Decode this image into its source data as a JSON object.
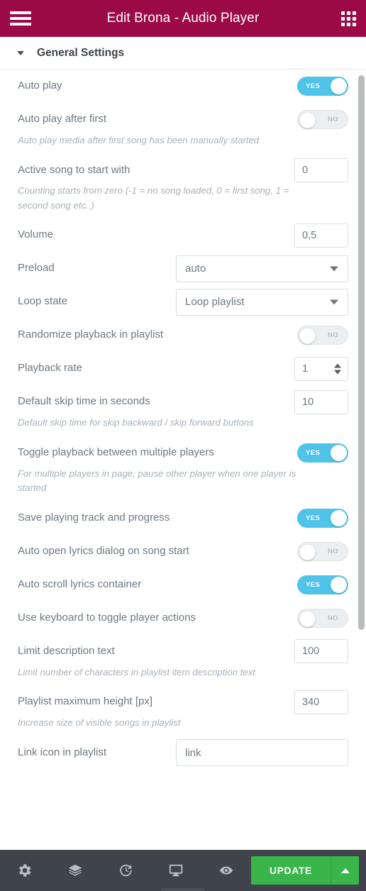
{
  "header": {
    "title": "Edit Brona - Audio Player",
    "menu_icon": "hamburger-icon",
    "apps_icon": "grid-apps-icon",
    "bg_color": "#9b0a46"
  },
  "section": {
    "title": "General Settings",
    "collapse_icon": "caret-down-icon"
  },
  "settings": [
    {
      "type": "toggle",
      "label": "Auto play",
      "value": "YES",
      "state": "on"
    },
    {
      "type": "toggle",
      "label": "Auto play after first",
      "value": "NO",
      "state": "off",
      "hint": "Auto play media after first song has been manually started"
    },
    {
      "type": "number",
      "label": "Active song to start with",
      "value": "0",
      "hint": "Counting starts from zero (-1 = no song loaded, 0 = first song, 1 = second song etc..)"
    },
    {
      "type": "number",
      "label": "Volume",
      "value": "0,5"
    },
    {
      "type": "select",
      "label": "Preload",
      "value": "auto"
    },
    {
      "type": "select",
      "label": "Loop state",
      "value": "Loop playlist"
    },
    {
      "type": "toggle",
      "label": "Randomize playback in playlist",
      "value": "NO",
      "state": "off"
    },
    {
      "type": "spinner",
      "label": "Playback rate",
      "value": "1"
    },
    {
      "type": "number",
      "label": "Default skip time in seconds",
      "value": "10",
      "hint": "Default skip time for skip backward / skip forward buttons"
    },
    {
      "type": "toggle",
      "label": "Toggle playback between multiple players",
      "value": "YES",
      "state": "on",
      "hint": "For multiple players in page, pause other player when one player is started"
    },
    {
      "type": "toggle",
      "label": "Save playing track and progress",
      "value": "YES",
      "state": "on"
    },
    {
      "type": "toggle",
      "label": "Auto open lyrics dialog on song start",
      "value": "NO",
      "state": "off"
    },
    {
      "type": "toggle",
      "label": "Auto scroll lyrics container",
      "value": "YES",
      "state": "on"
    },
    {
      "type": "toggle",
      "label": "Use keyboard to toggle player actions",
      "value": "NO",
      "state": "off"
    },
    {
      "type": "number",
      "label": "Limit description text",
      "value": "100",
      "hint": "Limit number of characters in playlist item description text"
    },
    {
      "type": "number",
      "label": "Playlist maximum height [px]",
      "value": "340",
      "hint": "Increase size of visible songs in playlist"
    },
    {
      "type": "text",
      "label": "Link icon in playlist",
      "value": "link"
    }
  ],
  "footer": {
    "icons": [
      {
        "name": "settings-gear-icon",
        "title": "Settings"
      },
      {
        "name": "layers-navigator-icon",
        "title": "Navigator"
      },
      {
        "name": "history-clock-icon",
        "title": "History"
      },
      {
        "name": "responsive-monitor-icon",
        "title": "Responsive Mode"
      },
      {
        "name": "preview-eye-icon",
        "title": "Preview Changes"
      }
    ],
    "update_label": "UPDATE",
    "update_color": "#39b54a",
    "update_caret_icon": "caret-up-icon"
  },
  "scrollbar": {
    "name": "vertical-scrollbar"
  }
}
